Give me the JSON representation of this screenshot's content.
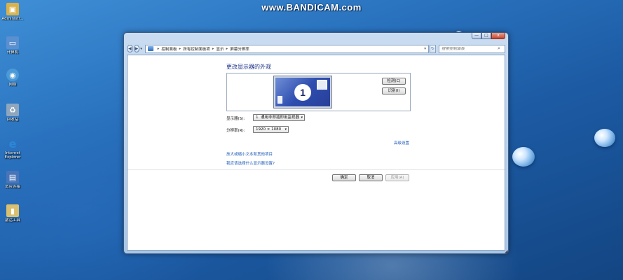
{
  "watermark": "www.BANDICAM.com",
  "desktop": {
    "icons": [
      {
        "label": "Administr...",
        "icon": "user-folder-icon",
        "color": "#d9b24a"
      },
      {
        "label": "计算机",
        "icon": "computer-icon",
        "color": "#5a8fd0"
      },
      {
        "label": "网络",
        "icon": "network-icon",
        "color": "#4a9ad8"
      },
      {
        "label": "回收站",
        "icon": "recycle-bin-icon",
        "color": "#8fa6bf"
      },
      {
        "label": "Internet Explorer",
        "icon": "internet-explorer-icon",
        "color": "#2d86d8"
      },
      {
        "label": "宽带连接",
        "icon": "broadband-connection-icon",
        "color": "#4a74b8"
      },
      {
        "label": "激活工具",
        "icon": "activation-tool-icon",
        "color": "#d8c070"
      }
    ]
  },
  "window": {
    "controls": {
      "minimize": "—",
      "maximize": "□",
      "close": "x"
    },
    "nav": {
      "back": "◀",
      "forward": "▶",
      "dropdown": "▾"
    },
    "breadcrumb": [
      "控制面板",
      "所有控制面板项",
      "显示",
      "屏幕分辨率"
    ],
    "breadcrumb_sep": "▸",
    "address_dropdown": "▾",
    "refresh": "↻",
    "search_placeholder": "搜索控制面板",
    "search_icon": "⌕"
  },
  "content": {
    "title": "更改显示器的外观",
    "monitor_number": "1",
    "detect_button": "检测(C)",
    "identify_button": "识别(I)",
    "display_label": "显示器(S):",
    "display_value": "1. 通用非即插即用监视器",
    "resolution_label": "分辨率(R):",
    "resolution_value": "1920 × 1080",
    "advanced_link": "高级设置",
    "link_text_size": "放大或缩小文本和其他项目",
    "link_which_settings": "我应该选择什么显示器设置?",
    "ok_button": "确定",
    "cancel_button": "取消",
    "apply_button": "应用(A)",
    "caret": "▾"
  }
}
